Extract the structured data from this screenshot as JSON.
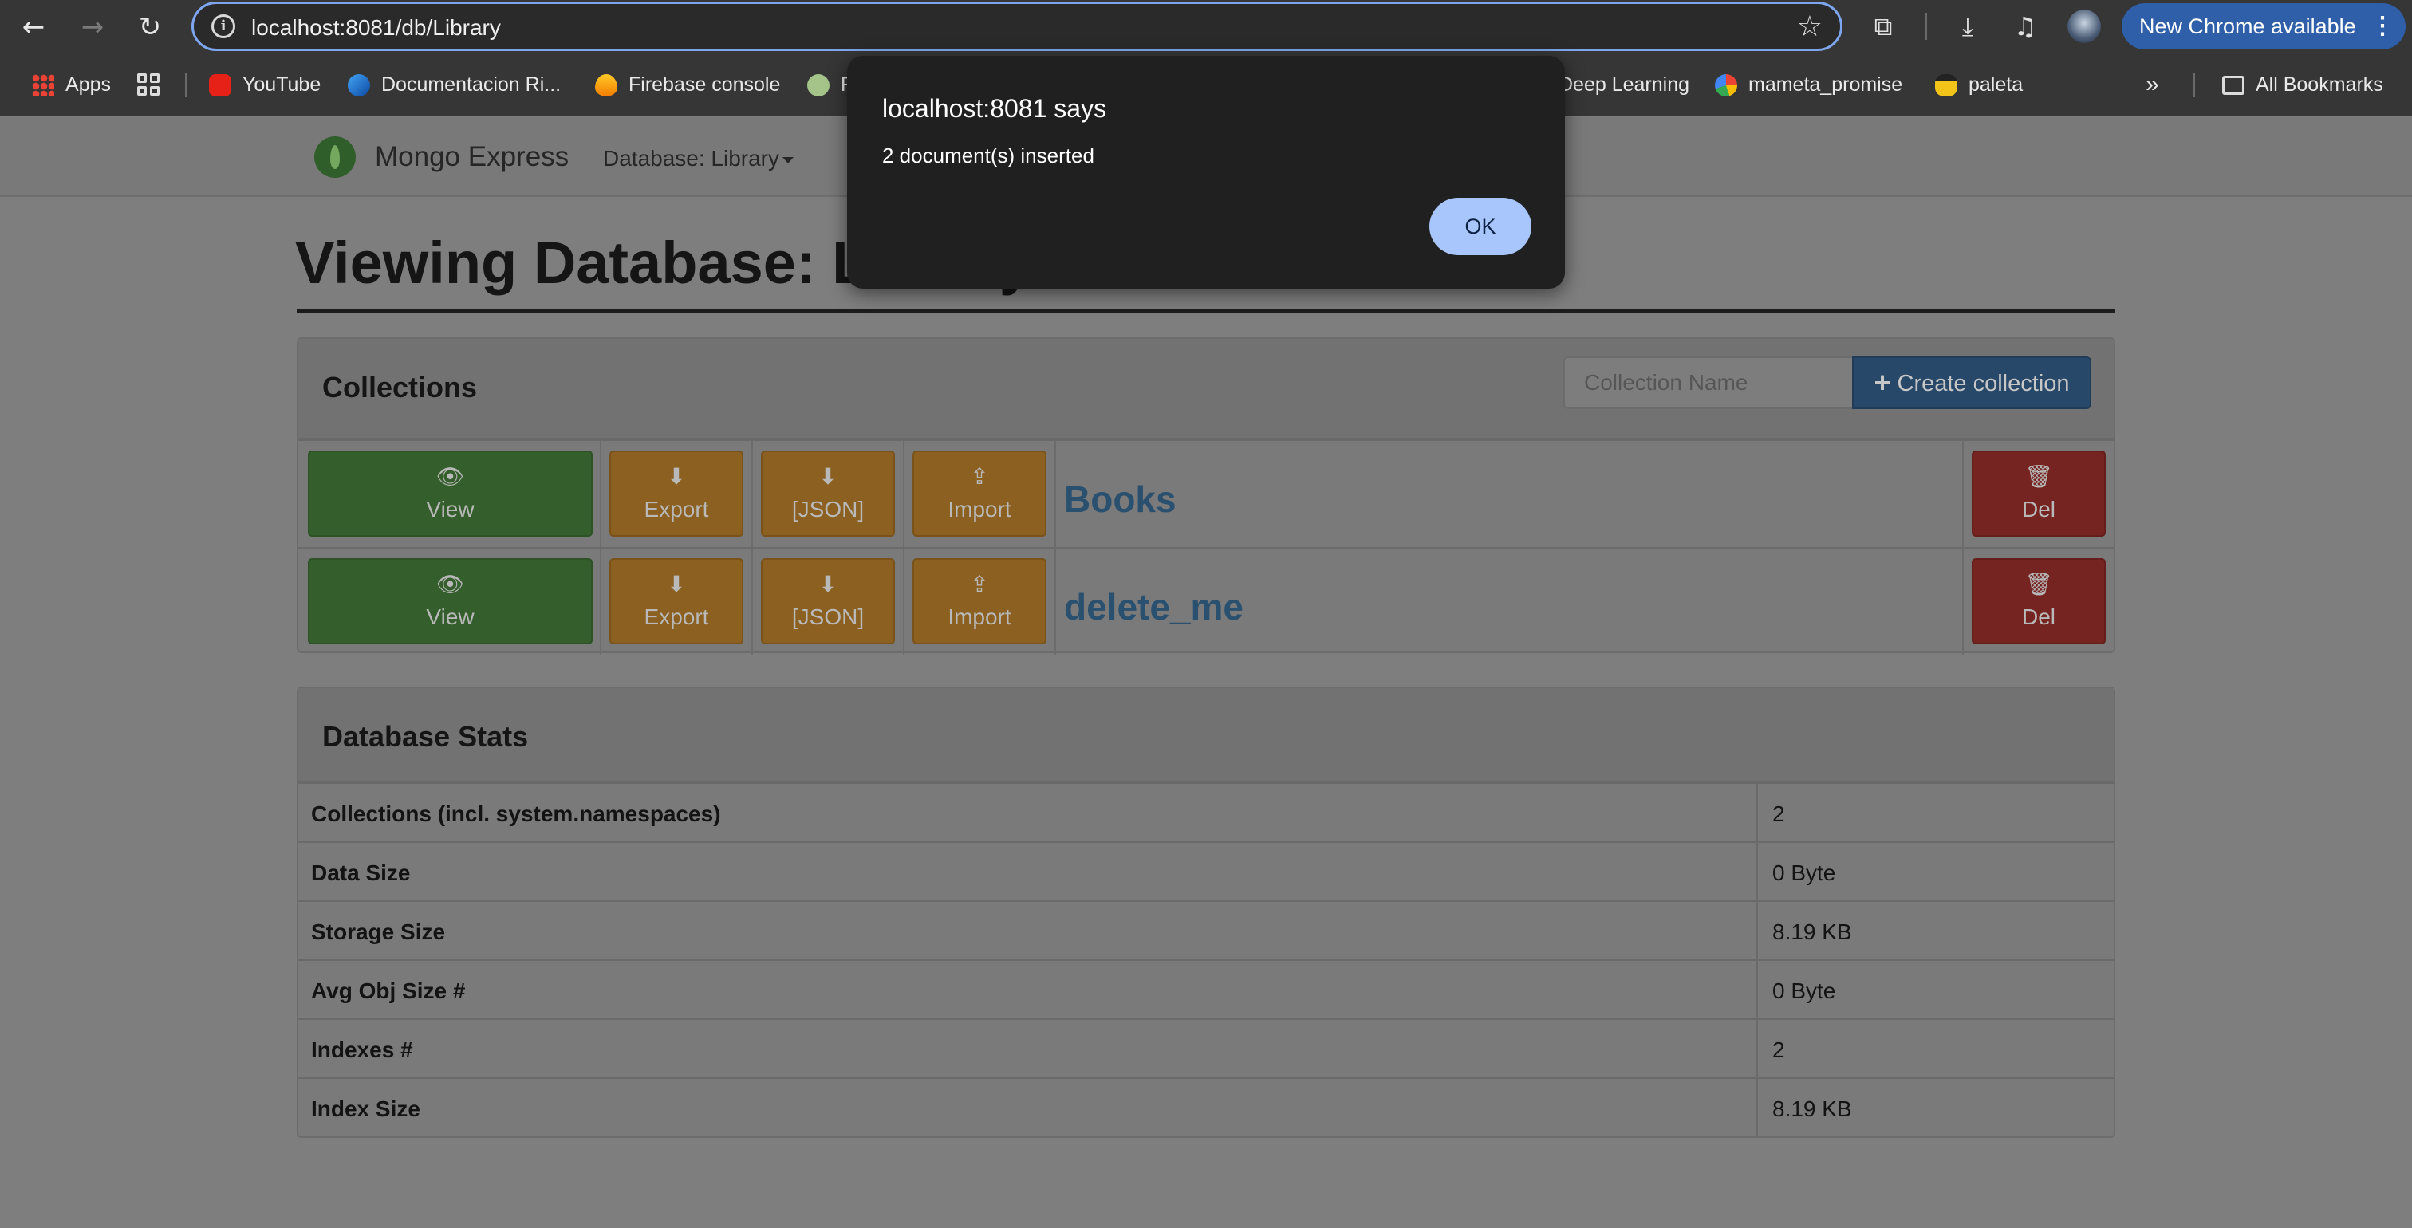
{
  "browser": {
    "url": "localhost:8081/db/Library",
    "update_label": "New Chrome available",
    "bookmarks": [
      {
        "label": "Apps",
        "icon": "apps-grid-icon"
      },
      {
        "label": "YouTube",
        "icon": "youtube-icon"
      },
      {
        "label": "Documentacion Ri...",
        "icon": "flutter-doc-icon"
      },
      {
        "label": "Firebase console",
        "icon": "firebase-icon"
      },
      {
        "label": "F",
        "icon": "site-icon"
      },
      {
        "label": "Deep Learning",
        "icon": "folder-icon"
      },
      {
        "label": "mameta_promise",
        "icon": "google-icon"
      },
      {
        "label": "paleta",
        "icon": "paleta-icon"
      }
    ],
    "all_bookmarks_label": "All Bookmarks"
  },
  "app": {
    "brand": "Mongo Express",
    "db_menu": "Database: Library"
  },
  "page": {
    "title": "Viewing Database: Library"
  },
  "collections_panel": {
    "title": "Collections",
    "input_placeholder": "Collection Name",
    "create_label": "Create collection",
    "buttons": {
      "view": "View",
      "export": "Export",
      "json": "[JSON]",
      "import": "Import",
      "del": "Del"
    },
    "rows": [
      {
        "name": "Books"
      },
      {
        "name": "delete_me"
      }
    ]
  },
  "stats_panel": {
    "title": "Database Stats",
    "rows": [
      {
        "key": "Collections (incl. system.namespaces)",
        "value": "2"
      },
      {
        "key": "Data Size",
        "value": "0 Byte"
      },
      {
        "key": "Storage Size",
        "value": "8.19 KB"
      },
      {
        "key": "Avg Obj Size #",
        "value": "0 Byte"
      },
      {
        "key": "Indexes #",
        "value": "2"
      },
      {
        "key": "Index Size",
        "value": "8.19 KB"
      }
    ]
  },
  "dialog": {
    "title": "localhost:8081 says",
    "message": "2 document(s) inserted",
    "ok_label": "OK"
  },
  "colors": {
    "view_button": "#345f2c",
    "export_button": "#8b6020",
    "delete_button": "#762421",
    "create_button": "#284869",
    "dialog_ok": "#a8c6fb"
  }
}
